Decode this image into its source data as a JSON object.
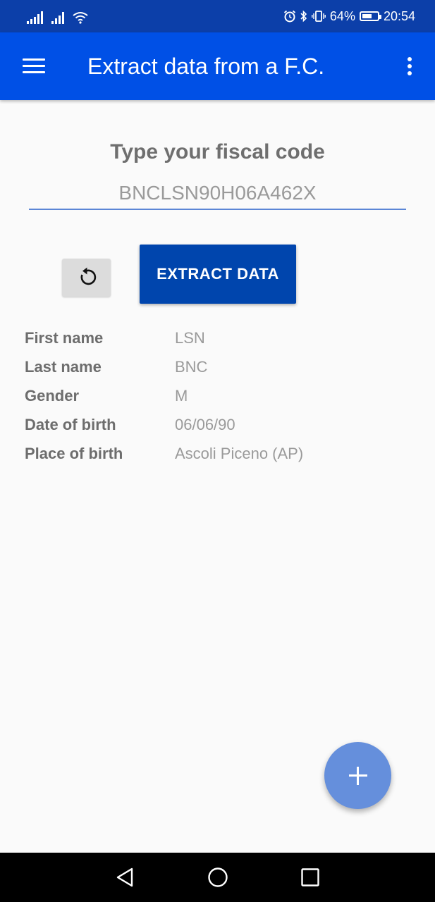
{
  "status_bar": {
    "battery_percent": "64%",
    "battery_level": 64,
    "time": "20:54"
  },
  "app_bar": {
    "title": "Extract data from a F.C."
  },
  "form": {
    "prompt": "Type your fiscal code",
    "fiscal_code_value": "BNCLSN90H06A462X",
    "extract_label": "EXTRACT DATA"
  },
  "details": [
    {
      "label": "First name",
      "value": "LSN"
    },
    {
      "label": "Last name",
      "value": "BNC"
    },
    {
      "label": "Gender",
      "value": "M"
    },
    {
      "label": "Date of birth",
      "value": "06/06/90"
    },
    {
      "label": "Place of birth",
      "value": "Ascoli Piceno (AP)"
    }
  ],
  "icons": {
    "menu": "menu-icon",
    "overflow": "more-vert-icon",
    "reset": "refresh-icon",
    "fab": "plus-icon",
    "nav_back": "back-triangle-icon",
    "nav_home": "home-circle-icon",
    "nav_recent": "recent-square-icon"
  },
  "colors": {
    "status_bar": "#0c3fa9",
    "app_bar": "#0050e6",
    "primary_button": "#0045ad",
    "fab": "#658fdc",
    "input_underline": "#5b86d6",
    "background": "#fafafa"
  }
}
